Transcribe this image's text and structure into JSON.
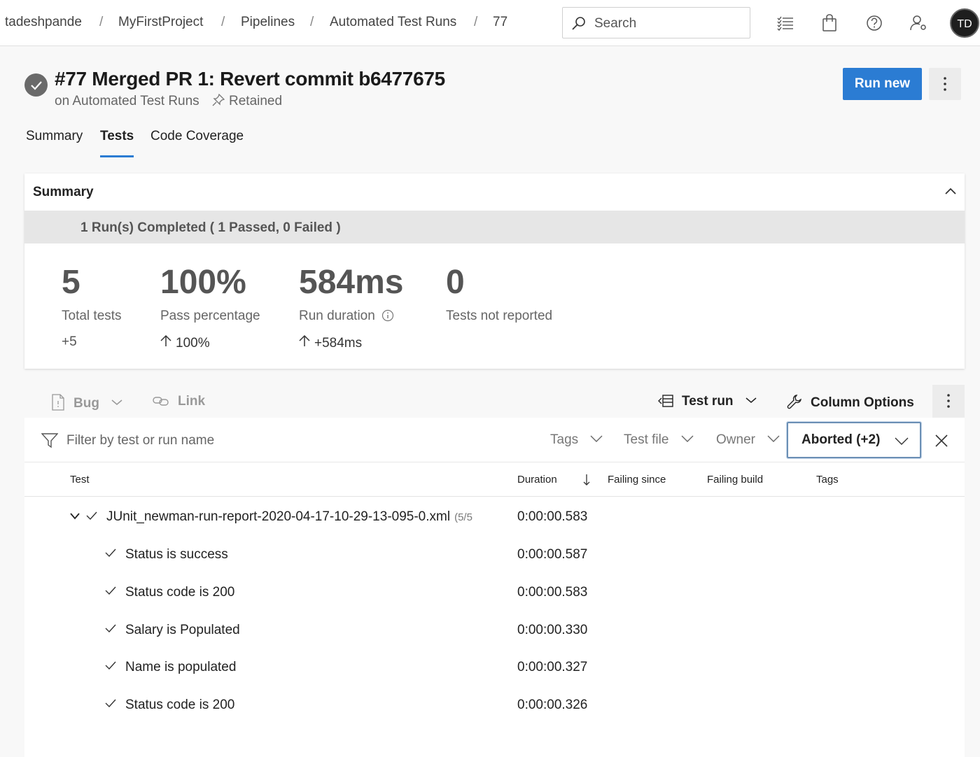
{
  "breadcrumb": {
    "items": [
      "tadeshpande",
      "MyFirstProject",
      "Pipelines",
      "Automated Test Runs",
      "77"
    ],
    "separator": "/"
  },
  "search": {
    "placeholder": "Search"
  },
  "header_icons": [
    "checklist-icon",
    "shopping-bag-icon",
    "help-icon",
    "user-settings-icon"
  ],
  "user": {
    "initials": "TD"
  },
  "run": {
    "title": "#77 Merged PR 1: Revert commit b6477675",
    "subtitle": "on Automated Test Runs",
    "retained_label": "Retained",
    "run_new_label": "Run new"
  },
  "tabs": [
    {
      "label": "Summary",
      "active": false
    },
    {
      "label": "Tests",
      "active": true
    },
    {
      "label": "Code Coverage",
      "active": false
    }
  ],
  "summary": {
    "title": "Summary",
    "banner": "1 Run(s) Completed ( 1 Passed, 0 Failed )",
    "metrics": [
      {
        "value": "5",
        "label": "Total tests",
        "delta": "+5",
        "delta_arrow": false
      },
      {
        "value": "100%",
        "label": "Pass percentage",
        "delta": "100%",
        "delta_arrow": true
      },
      {
        "value": "584ms",
        "label": "Run duration",
        "delta": "+584ms",
        "delta_arrow": true,
        "info_icon": true
      },
      {
        "value": "0",
        "label": "Tests not reported",
        "delta": "",
        "delta_arrow": false
      }
    ]
  },
  "toolbar": {
    "bug_label": "Bug",
    "link_label": "Link",
    "test_run_label": "Test run",
    "column_options_label": "Column Options"
  },
  "filter": {
    "placeholder": "Filter by test or run name",
    "dropdowns": [
      "Tags",
      "Test file",
      "Owner"
    ],
    "outcome_label": "Aborted (+2)"
  },
  "columns": {
    "test": "Test",
    "duration": "Duration",
    "failing_since": "Failing since",
    "failing_build": "Failing build",
    "tags": "Tags"
  },
  "results": {
    "group": {
      "name": "JUnit_newman-run-report-2020-04-17-10-29-13-095-0.xml",
      "count": "(5/5",
      "duration": "0:00:00.583"
    },
    "tests": [
      {
        "name": "Status is success",
        "duration": "0:00:00.587"
      },
      {
        "name": "Status code is 200",
        "duration": "0:00:00.583"
      },
      {
        "name": "Salary is Populated",
        "duration": "0:00:00.330"
      },
      {
        "name": "Name is populated",
        "duration": "0:00:00.327"
      },
      {
        "name": "Status code is 200",
        "duration": "0:00:00.326"
      }
    ]
  },
  "colors": {
    "accent": "#2b7cd3",
    "status_gray": "#6a6a6a"
  }
}
